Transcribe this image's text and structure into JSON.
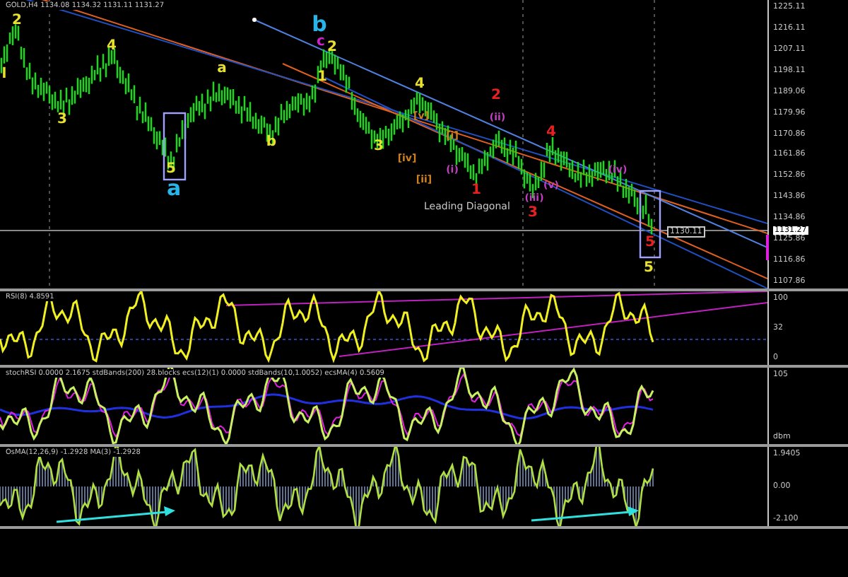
{
  "symbol_header": "GOLD,H4 1134.08 1134.32 1131.11 1131.27",
  "price_axis": [
    "1225.11",
    "1216.11",
    "1207.11",
    "1198.11",
    "1189.06",
    "1179.96",
    "1170.86",
    "1161.86",
    "1152.86",
    "1143.86",
    "1134.86",
    "1125.86",
    "1116.86",
    "1107.86"
  ],
  "current_price": "1131.27",
  "line_price": "1130.11",
  "annotation": "Leading Diagonal",
  "wave_labels": [
    {
      "text": "2",
      "color": "#e8e030",
      "kind": "intermediate"
    },
    {
      "text": "l",
      "color": "#e8e030",
      "kind": "intermediate"
    },
    {
      "text": "3",
      "color": "#e8e030",
      "kind": "intermediate"
    },
    {
      "text": "4",
      "color": "#e8e030",
      "kind": "intermediate"
    },
    {
      "text": "5",
      "color": "#e8e030",
      "kind": "intermediate"
    },
    {
      "text": "a",
      "color": "#28b4e8",
      "kind": "primary"
    },
    {
      "text": "a",
      "color": "#e8e030",
      "kind": "intermediate"
    },
    {
      "text": "b",
      "color": "#e8e030",
      "kind": "intermediate"
    },
    {
      "text": "b",
      "color": "#28b4e8",
      "kind": "primary"
    },
    {
      "text": "c",
      "color": "#d020d0",
      "kind": "intermediate"
    },
    {
      "text": "2",
      "color": "#e8e030",
      "kind": "intermediate"
    },
    {
      "text": "1",
      "color": "#e8e030",
      "kind": "intermediate"
    },
    {
      "text": "3",
      "color": "#e8e030",
      "kind": "intermediate"
    },
    {
      "text": "4",
      "color": "#e8e030",
      "kind": "intermediate"
    },
    {
      "text": "2",
      "color": "#e82020",
      "kind": "intermediate"
    },
    {
      "text": "4",
      "color": "#e82020",
      "kind": "intermediate"
    },
    {
      "text": "1",
      "color": "#e82020",
      "kind": "intermediate"
    },
    {
      "text": "3",
      "color": "#e82020",
      "kind": "intermediate"
    },
    {
      "text": "5",
      "color": "#e82020",
      "kind": "intermediate"
    },
    {
      "text": "5",
      "color": "#e8e030",
      "kind": "intermediate"
    },
    {
      "text": "(i)",
      "color": "#c040c0",
      "kind": "minor"
    },
    {
      "text": "(ii)",
      "color": "#c040c0",
      "kind": "minor"
    },
    {
      "text": "(iii)",
      "color": "#c040c0",
      "kind": "minor"
    },
    {
      "text": "(iv)",
      "color": "#c040c0",
      "kind": "minor"
    },
    {
      "text": "(v)",
      "color": "#c040c0",
      "kind": "minor"
    },
    {
      "text": "[i]",
      "color": "#d08020",
      "kind": "minor"
    },
    {
      "text": "[ii]",
      "color": "#d08020",
      "kind": "minor"
    },
    {
      "text": "[iv]",
      "color": "#d08020",
      "kind": "minor"
    },
    {
      "text": "[v]",
      "color": "#d08020",
      "kind": "minor"
    }
  ],
  "rsi": {
    "header": "RSI(8) 4.8591",
    "axis": [
      "100",
      "32",
      "0"
    ]
  },
  "stoch": {
    "header": "stochRSI 0.0000 2.1675  stdBands(200) 28.blocks  ecs(12)(1) 0.0000  stdBands(10,1.0052)  ecsMA(4) 0.5609",
    "axis": [
      "105",
      "dbm"
    ]
  },
  "osma": {
    "header": "OsMA(12,26,9) -1.2928  MA(3) -1.2928",
    "axis": [
      "1.9405",
      "0.00",
      "-2.100"
    ]
  }
}
